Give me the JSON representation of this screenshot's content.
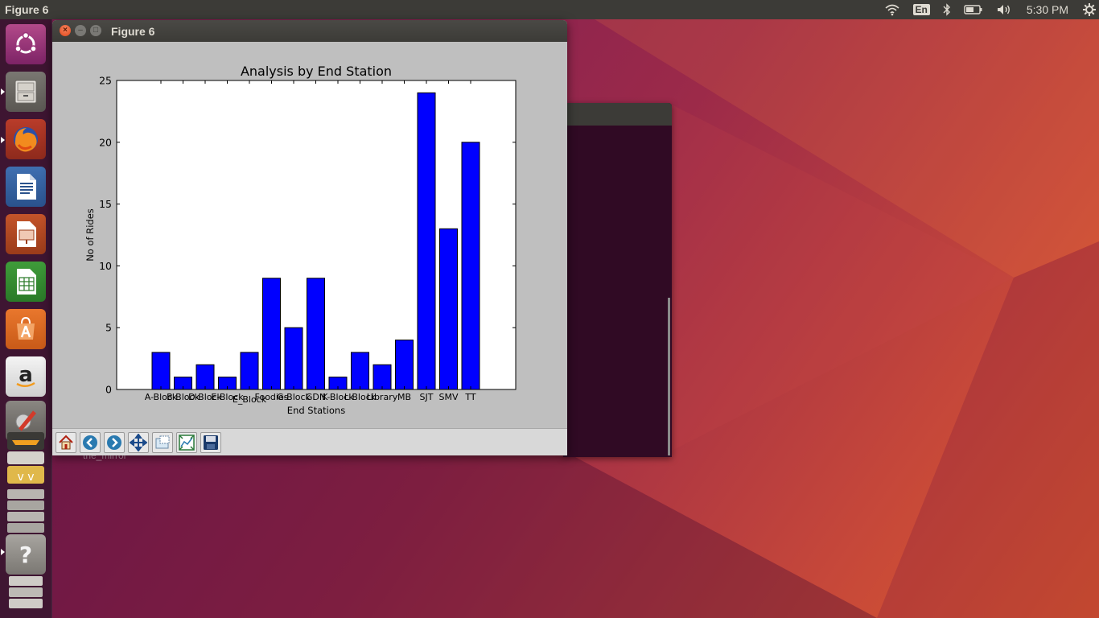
{
  "top_panel": {
    "title": "Figure 6",
    "keyboard_layout": "En",
    "clock": "5:30 PM"
  },
  "launcher": {
    "items": [
      {
        "name": "ubuntu-dash",
        "icon": "ubuntu-logo-icon"
      },
      {
        "name": "files",
        "icon": "file-cabinet-icon"
      },
      {
        "name": "firefox",
        "icon": "firefox-icon"
      },
      {
        "name": "libreoffice-writer",
        "icon": "writer-icon"
      },
      {
        "name": "libreoffice-impress",
        "icon": "impress-icon"
      },
      {
        "name": "libreoffice-calc",
        "icon": "calc-icon"
      },
      {
        "name": "ubuntu-software",
        "icon": "software-center-icon"
      },
      {
        "name": "amazon",
        "icon": "amazon-icon"
      },
      {
        "name": "system-settings",
        "icon": "settings-wrench-icon"
      },
      {
        "name": "stacked-apps",
        "icon": "stacked-windows-icon"
      },
      {
        "name": "help",
        "icon": "question-mark-icon",
        "label": "?"
      },
      {
        "name": "trash-stack",
        "icon": "stacked-drives-icon"
      }
    ]
  },
  "desktop": {
    "label": "the_mirror"
  },
  "figure_window": {
    "title": "Figure 6",
    "controls": {
      "close": "×",
      "minimize": "–",
      "maximize": "□"
    },
    "toolbar": [
      {
        "name": "home",
        "icon": "home-icon"
      },
      {
        "name": "back",
        "icon": "back-arrow-icon"
      },
      {
        "name": "forward",
        "icon": "forward-arrow-icon"
      },
      {
        "name": "pan",
        "icon": "move-arrows-icon"
      },
      {
        "name": "zoom",
        "icon": "zoom-rect-icon"
      },
      {
        "name": "configure-subplots",
        "icon": "subplots-icon"
      },
      {
        "name": "save",
        "icon": "floppy-disk-icon"
      }
    ]
  },
  "chart_data": {
    "type": "bar",
    "title": "Analysis by End Station",
    "xlabel": "End Stations",
    "ylabel": "No of Rides",
    "categories": [
      "A-Block",
      "B-Block",
      "D-Block",
      "E-Block",
      "E_Block",
      "Foodies",
      "G-Block",
      "GDN",
      "K-Block",
      "L-Block",
      "Library",
      "MB",
      "SJT",
      "SMV",
      "TT"
    ],
    "values": [
      3,
      1,
      2,
      1,
      3,
      9,
      5,
      9,
      1,
      3,
      2,
      4,
      24,
      13,
      20
    ],
    "ylim": [
      0,
      25
    ],
    "yticks": [
      0,
      5,
      10,
      15,
      20,
      25
    ],
    "bar_color": "#0000ff",
    "grid": false,
    "legend": "none"
  }
}
